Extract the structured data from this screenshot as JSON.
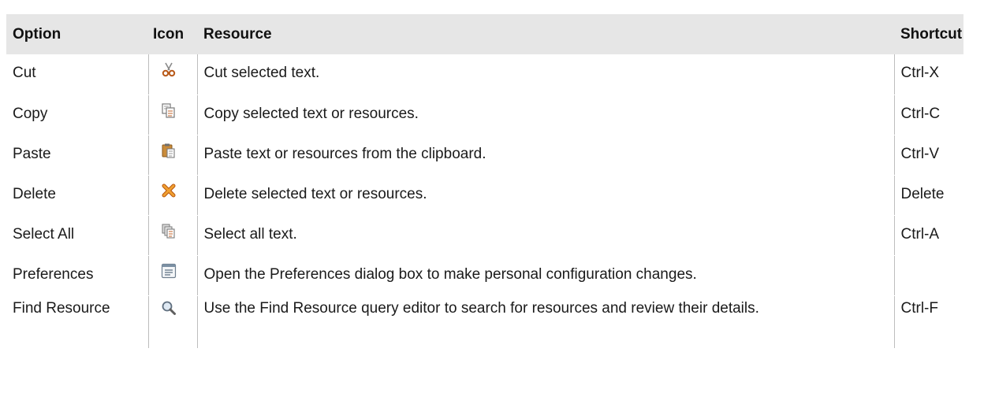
{
  "table": {
    "headers": {
      "option": "Option",
      "icon": "Icon",
      "resource": "Resource",
      "shortcut": "Shortcut"
    },
    "rows": [
      {
        "option": "Cut",
        "icon": "scissors-icon",
        "resource": "Cut selected text.",
        "shortcut": "Ctrl-X"
      },
      {
        "option": "Copy",
        "icon": "copy-icon",
        "resource": "Copy selected text or resources.",
        "shortcut": "Ctrl-C"
      },
      {
        "option": "Paste",
        "icon": "paste-icon",
        "resource": "Paste text or resources from the clipboard.",
        "shortcut": "Ctrl-V"
      },
      {
        "option": "Delete",
        "icon": "delete-x-icon",
        "resource": "Delete selected text or resources.",
        "shortcut": "Delete"
      },
      {
        "option": "Select All",
        "icon": "select-all-icon",
        "resource": "Select all text.",
        "shortcut": "Ctrl-A"
      },
      {
        "option": "Preferences",
        "icon": "preferences-window-icon",
        "resource": "Open the Preferences dialog box to make personal configuration changes.",
        "shortcut": ""
      },
      {
        "option": "Find Resource",
        "icon": "magnifier-icon",
        "resource": "Use the Find Resource query editor to search for resources and review their details.",
        "shortcut": "Ctrl-F"
      }
    ]
  },
  "colors": {
    "header_bg": "#e6e6e6",
    "divider": "#bdbdbd",
    "cut_icon": "#b85a1a",
    "delete_icon": "#e07a18"
  }
}
